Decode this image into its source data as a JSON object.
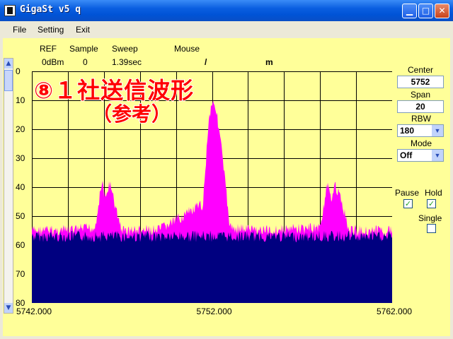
{
  "window": {
    "title": "GigaSt v5 q"
  },
  "menu": [
    "File",
    "Setting",
    "Exit"
  ],
  "header": {
    "ref_label": "REF",
    "ref_value": "0dBm",
    "sample_label": "Sample",
    "sample_value": "0",
    "sweep_label": "Sweep",
    "sweep_value": "1.39sec",
    "mouse_label": "Mouse",
    "mouse_value": "/",
    "mouse_unit": "m"
  },
  "overlay": {
    "line1": "⑧１社送信波形",
    "line2": "（参考）"
  },
  "controls": {
    "center_label": "Center",
    "center_value": "5752",
    "span_label": "Span",
    "span_value": "20",
    "rbw_label": "RBW",
    "rbw_value": "180",
    "mode_label": "Mode",
    "mode_value": "Off",
    "pause_label": "Pause",
    "pause_checked": true,
    "hold_label": "Hold",
    "hold_checked": true,
    "single_label": "Single",
    "single_checked": false
  },
  "colors": {
    "background": "#ffff99",
    "grid": "#000000",
    "noise_floor": "#000080",
    "trace": "#ff00ff",
    "overlay_text": "#ff0000"
  },
  "chart_data": {
    "type": "area",
    "x_ticks": [
      "5742.000",
      "5752.000",
      "5762.000"
    ],
    "y_ticks": [
      "0",
      "10",
      "20",
      "30",
      "40",
      "50",
      "60",
      "70",
      "80"
    ],
    "xlim": [
      5742,
      5762
    ],
    "ylim": [
      0,
      80
    ],
    "y_inverted": true,
    "grid": true,
    "series": [
      {
        "x": [
          5742.0,
          5744.0,
          5745.5,
          5745.9,
          5746.1,
          5746.3,
          5746.6,
          5747.0,
          5749.0,
          5751.5,
          5751.8,
          5752.0,
          5752.2,
          5752.5,
          5753.0,
          5755.0,
          5758.0,
          5758.4,
          5758.6,
          5758.8,
          5759.0,
          5759.2,
          5759.6,
          5762.0
        ],
        "y": [
          55,
          55,
          54,
          38,
          45,
          38,
          46,
          55,
          55,
          46,
          18,
          10,
          12,
          25,
          54,
          55,
          54,
          39,
          45,
          38,
          42,
          45,
          55,
          55
        ]
      }
    ]
  }
}
